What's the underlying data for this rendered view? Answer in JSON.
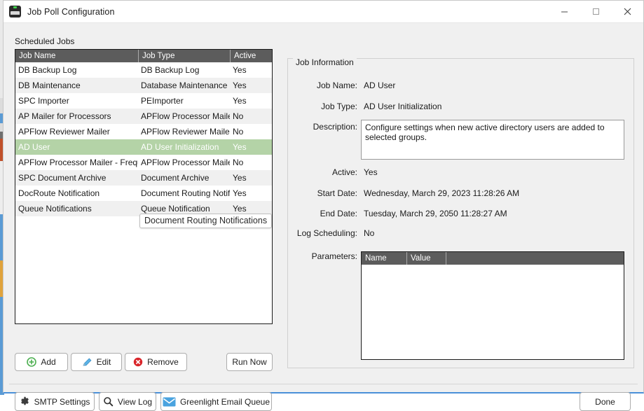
{
  "window": {
    "title": "Job Poll Configuration",
    "icon": "app-icon",
    "controls": {
      "minimize": "minimize-icon",
      "maximize": "maximize-icon",
      "close": "close-icon"
    },
    "accent_color": "#4a90d9"
  },
  "scheduled_jobs": {
    "label": "Scheduled Jobs",
    "columns": [
      "Job Name",
      "Job Type",
      "Active"
    ],
    "rows": [
      {
        "name": "DB Backup Log",
        "type": "DB Backup Log",
        "active": "Yes"
      },
      {
        "name": "DB Maintenance",
        "type": "Database Maintenance",
        "active": "Yes"
      },
      {
        "name": "SPC Importer",
        "type": "PEImporter",
        "active": "Yes"
      },
      {
        "name": "AP Mailer for Processors",
        "type": "APFlow Processor Mailer",
        "active": "No"
      },
      {
        "name": "APFlow Reviewer Mailer",
        "type": "APFlow Reviewer Mailer",
        "active": "No"
      },
      {
        "name": "AD User",
        "type": "AD User Initialization",
        "active": "Yes"
      },
      {
        "name": "APFlow Processor Mailer - Frequent",
        "type": "APFlow Processor Mailer",
        "active": "No"
      },
      {
        "name": "SPC Document Archive",
        "type": "Document Archive",
        "active": "Yes"
      },
      {
        "name": "DocRoute Notification",
        "type": "Document Routing Notifications",
        "active": "Yes"
      },
      {
        "name": "Queue Notifications",
        "type": "Queue Notification",
        "active": "Yes"
      }
    ],
    "selected_index": 5,
    "selected_color": "#b4d3a7",
    "header_color": "#5c5c5c"
  },
  "tooltip": {
    "text": "Document Routing Notifications"
  },
  "list_actions": {
    "add": {
      "label": "Add",
      "icon": "plus-circle-icon",
      "color": "#4caf50"
    },
    "edit": {
      "label": "Edit",
      "icon": "pencil-icon",
      "color": "#4aa3df"
    },
    "remove": {
      "label": "Remove",
      "icon": "remove-circle-icon",
      "color": "#d9252a"
    },
    "run_now": {
      "label": "Run Now"
    }
  },
  "job_information": {
    "legend": "Job Information",
    "fields": [
      {
        "label": "Job Name:",
        "value": "AD User"
      },
      {
        "label": "Job Type:",
        "value": "AD User Initialization"
      },
      {
        "label": "Description:",
        "value": "Configure settings when new active directory users are added to selected groups."
      },
      {
        "label": "Active:",
        "value": "Yes"
      },
      {
        "label": "Start Date:",
        "value": "Wednesday, March 29, 2023 11:28:26 AM"
      },
      {
        "label": "End Date:",
        "value": "Tuesday, March 29, 2050 11:28:27 AM"
      },
      {
        "label": "Log Scheduling:",
        "value": "No"
      },
      {
        "label": "Parameters:",
        "value": ""
      }
    ],
    "parameters_table": {
      "columns": [
        "Name",
        "Value",
        ""
      ],
      "rows": []
    }
  },
  "footer_actions": {
    "smtp": {
      "label": "SMTP Settings",
      "icon": "gear-icon"
    },
    "view_log": {
      "label": "View Log",
      "icon": "search-icon"
    },
    "greenlight": {
      "label": "Greenlight Email Queue",
      "icon": "envelope-icon",
      "color": "#4aa3df"
    },
    "done": {
      "label": "Done"
    }
  }
}
